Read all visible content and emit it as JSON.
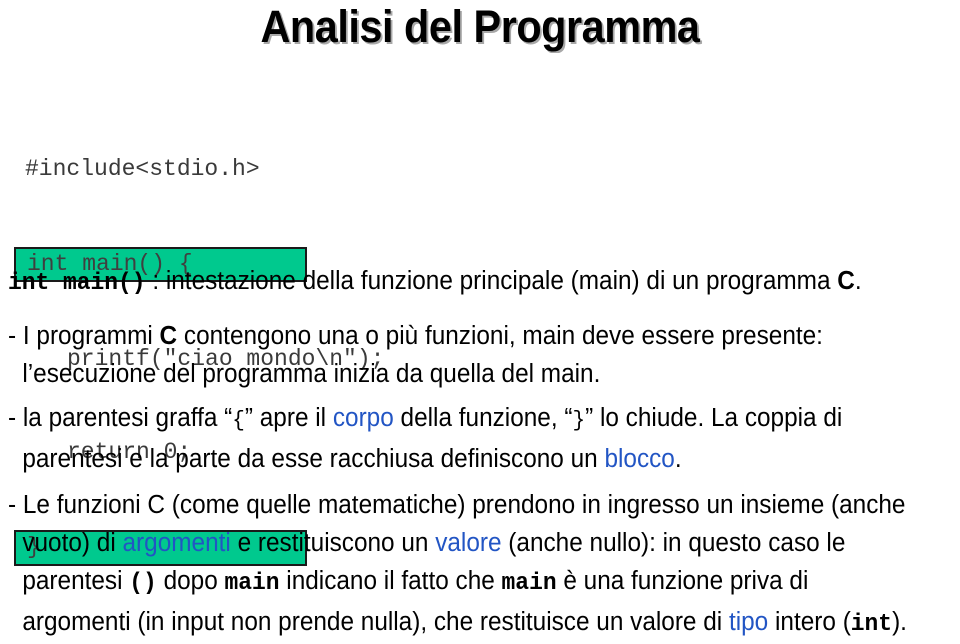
{
  "slide": {
    "title": "Analisi del Programma",
    "title_shadow_color": "#a8a8a8",
    "background_color": "#ffffff",
    "accent_highlight_color": "#00c98e",
    "link_color": "#2255c4"
  },
  "code_block": {
    "language": "C",
    "lines": [
      {
        "text": "#include<stdio.h>",
        "highlighted": false,
        "indented": false
      },
      {
        "text": "int main() {",
        "highlighted": true,
        "indented": false
      },
      {
        "text": "printf(\"ciao mondo\\n\");",
        "highlighted": false,
        "indented": true
      },
      {
        "text": "return 0;",
        "highlighted": false,
        "indented": true
      },
      {
        "text": "}",
        "highlighted": true,
        "indented": false
      }
    ]
  },
  "paragraphs": {
    "p1": {
      "code": "int main()",
      "rest": " : intestazione della funzione principale (main) di un programma ",
      "bold_tail": "C",
      "end": "."
    },
    "p2": {
      "bullet": "- I programmi ",
      "bold1": "C",
      "text1": " contengono una o più funzioni, main deve essere presente:",
      "line2": "l’esecuzione del  programma inizia da quella del main."
    },
    "p3": {
      "bullet": "- la parentesi graffa “",
      "brace_open": "{",
      "text1": "” apre il ",
      "link1": "corpo",
      "text2": " della funzione, “",
      "brace_close": "}",
      "text3": "” lo chiude.  La coppia di",
      "line2a": "parentesi e la parte da esse racchiusa definiscono un ",
      "link2": "blocco",
      "line2b": "."
    },
    "p4": {
      "bullet": "- Le funzioni C (come quelle matematiche) prendono in ingresso un insieme (anche",
      "line2a": "vuoto) di ",
      "link1": "argomenti",
      "line2b": " e restituiscono un ",
      "link2": "valore",
      "line2c": " (anche nullo): in questo caso le",
      "line3a": "parentesi ",
      "code1": "()",
      "line3b": " dopo ",
      "code2": "main",
      "line3c": " indicano il fatto che ",
      "code3": "main",
      "line3d": " è una  funzione priva di",
      "line4a": "argomenti (in input non prende nulla), che restituisce un valore di ",
      "link3": "tipo",
      "line4b": " intero (",
      "code4": "int",
      "line4c": ")."
    }
  }
}
